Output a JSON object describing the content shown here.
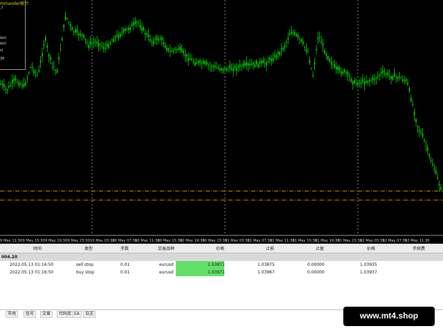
{
  "indicator": {
    "title": "mmander统计",
    "lines": [
      ",7",
      "ips)",
      "ips)",
      "s)",
      "30"
    ]
  },
  "chart": {
    "x_labels": [
      "9 May 11:30",
      "9 May 15:30",
      "9 May 19:30",
      "9 May 23:30",
      "10 May 03:30",
      "10 May 07:30",
      "10 May 11:30",
      "10 May 15:30",
      "10 May 19:30",
      "10 May 23:30",
      "11 May 03:30",
      "11 May 07:30",
      "11 May 11:30",
      "11 May 15:30",
      "11 May 19:30",
      "11 May 23:30",
      "12 May 03:30",
      "12 May 07:30",
      "12 May 11:30"
    ],
    "up_color": "#00e000",
    "line_colors": [
      "#c8a000",
      "#c8a000"
    ]
  },
  "terminal": {
    "headers": [
      "时间",
      "类型",
      "手数",
      "交易品种",
      "价格",
      "止损",
      "止盈",
      "价格",
      "手续费"
    ],
    "group_label": "004.20",
    "rows": [
      {
        "time": "2022.05.13 01:16:50",
        "type": "sell stop",
        "lots": "0.01",
        "symbol": "eurusd",
        "price": "1.03871",
        "sl": "1.03875",
        "tp": "0.00000",
        "cur": "1.03935"
      },
      {
        "time": "2022.05.13 01:16:50",
        "type": "buy stop",
        "lots": "0.01",
        "symbol": "eurusd",
        "price": "1.03971",
        "sl": "1.03967",
        "tp": "0.00000",
        "cur": "1.03937"
      }
    ]
  },
  "tabs": [
    "市场",
    "信号",
    "文章",
    "代码库",
    "EA",
    "日志"
  ],
  "brand": "www.mt4.shop"
}
